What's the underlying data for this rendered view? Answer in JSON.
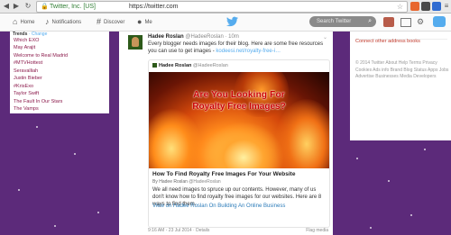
{
  "browser": {
    "site_name": "Twitter, Inc. [US]",
    "url": "https://twitter.com"
  },
  "topnav": {
    "home": "Home",
    "notifications": "Notifications",
    "discover": "Discover",
    "me": "Me",
    "search_placeholder": "Search Twitter"
  },
  "trends": {
    "header_label": "Trends",
    "change": "· Change",
    "items": [
      "Which EXO",
      "May Arajit",
      "Welcome to Real Madrid",
      "#MTVHottest",
      "Seravalliah",
      "Justin Bieber",
      "#KrisExo",
      "Taylor Swift",
      "The Fault In Our Stars",
      "The Vamps"
    ]
  },
  "tweet": {
    "author_name": "Hadee Roslan",
    "author_handle": "@HadeeRoslan",
    "time": "· 10m",
    "text_1": "Every blogger needs images for their blog. Here are some free resources you",
    "text_2": "can use to get images - ",
    "link": "kodeesi.net/royalty-free-i…",
    "card": {
      "author_name": "Hadee Roslan",
      "author_handle": "@HadeeRoslan",
      "image_line_1": "Are You Looking For",
      "image_line_2": "Royalty Free Images?",
      "title": "How To Find Royalty Free Images For Your Website",
      "by_label": "By ",
      "by_name": "Hadee Roslan",
      "by_handle": " @HadeeRoslan",
      "description": "We all need images to spruce up our contents. However, many of us don't know how to find royalty free images for our websites. Here are 8 ways to find them.",
      "link_text": "View on Hadee Roslan On Building An Online Business"
    },
    "timestamp": "9:16 AM - 23 Jul 2014 · Details",
    "flag": "Flag media"
  },
  "right_panel": {
    "connect_link": "Connect other address books",
    "footer": "© 2014 Twitter  About  Help  Terms  Privacy  Cookies  Ads info  Brand  Blog  Status  Apps  Jobs  Advertise  Businesses  Media  Developers"
  },
  "colors": {
    "accent": "#55acee",
    "background": "#5c2a7a",
    "trend_text": "#8b1a4b"
  }
}
